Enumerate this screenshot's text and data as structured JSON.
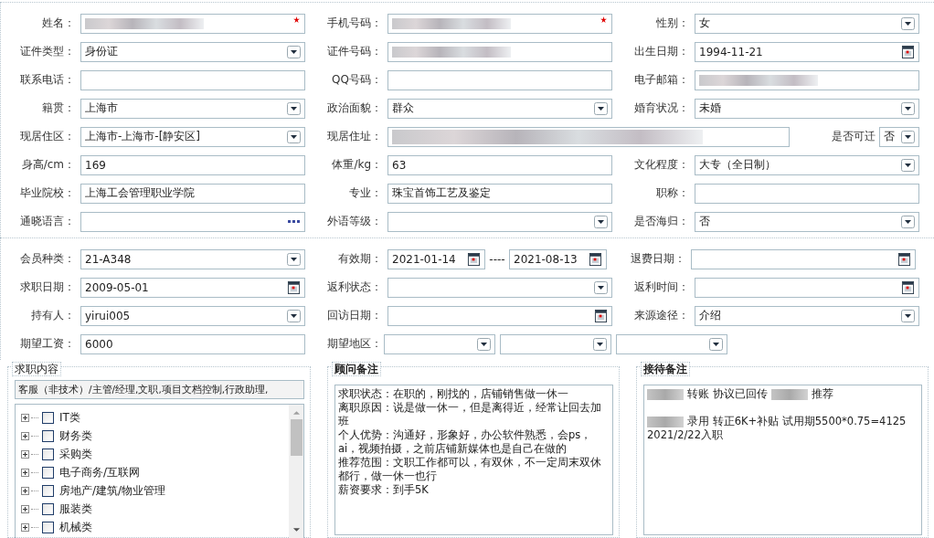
{
  "personal": [
    [
      {
        "label": "姓名：",
        "kind": "text",
        "redacted": true,
        "required": true
      },
      {
        "label": "手机号码：",
        "kind": "text",
        "redacted": true,
        "required": true
      },
      {
        "label": "性别：",
        "kind": "select",
        "value": "女"
      }
    ],
    [
      {
        "label": "证件类型：",
        "kind": "select",
        "value": "身份证"
      },
      {
        "label": "证件号码：",
        "kind": "text",
        "redacted": true
      },
      {
        "label": "出生日期：",
        "kind": "date",
        "value": "1994-11-21"
      }
    ],
    [
      {
        "label": "联系电话：",
        "kind": "text"
      },
      {
        "label": "QQ号码：",
        "kind": "text"
      },
      {
        "label": "电子邮箱：",
        "kind": "text",
        "redacted": true
      }
    ],
    [
      {
        "label": "籍贯：",
        "kind": "select",
        "value": "上海市"
      },
      {
        "label": "政治面貌：",
        "kind": "select",
        "value": "群众"
      },
      {
        "label": "婚育状况：",
        "kind": "select",
        "value": "未婚"
      }
    ],
    [
      {
        "label": "现居住区：",
        "kind": "select",
        "value": "上海市-上海市-[静安区]"
      },
      {
        "label": "现居住址：",
        "kind": "text",
        "redacted": true,
        "wide": true
      },
      {
        "label": "是否可迁",
        "kind": "select",
        "value": "否",
        "compact": true
      }
    ],
    [
      {
        "label": "身高/cm：",
        "kind": "text",
        "value": "169"
      },
      {
        "label": "体重/kg：",
        "kind": "text",
        "value": "63"
      },
      {
        "label": "文化程度：",
        "kind": "select",
        "value": "大专（全日制）"
      }
    ],
    [
      {
        "label": "毕业院校：",
        "kind": "text",
        "value": "上海工会管理职业学院"
      },
      {
        "label": "专业：",
        "kind": "text",
        "value": "珠宝首饰工艺及鉴定"
      },
      {
        "label": "职称：",
        "kind": "text"
      }
    ],
    [
      {
        "label": "通晓语言：",
        "kind": "lookup"
      },
      {
        "label": "外语等级：",
        "kind": "select"
      },
      {
        "label": "是否海归：",
        "kind": "select",
        "value": "否"
      }
    ]
  ],
  "membership": [
    [
      {
        "label": "会员种类：",
        "kind": "select",
        "value": "21-A348"
      },
      {
        "label": "有效期：",
        "kind": "date_range",
        "value": "2021-01-14",
        "separator": "----",
        "value_to": "2021-08-13"
      },
      {
        "label": "退费日期：",
        "kind": "date"
      }
    ],
    [
      {
        "label": "求职日期：",
        "kind": "date",
        "value": "2009-05-01"
      },
      {
        "label": "返利状态：",
        "kind": "select"
      },
      {
        "label": "返利时间：",
        "kind": "date"
      }
    ],
    [
      {
        "label": "持有人：",
        "kind": "select",
        "value": "yirui005"
      },
      {
        "label": "回访日期：",
        "kind": "date"
      },
      {
        "label": "来源途径：",
        "kind": "select",
        "value": "介绍"
      }
    ],
    [
      {
        "label": "期望工资：",
        "kind": "text",
        "value": "6000"
      },
      {
        "label": "期望地区：",
        "kind": "region"
      }
    ]
  ],
  "job_content": {
    "title": "求职内容",
    "summary": "客服（非技术）/主管/经理,文职,项目文档控制,行政助理,",
    "tree": [
      {
        "label": "IT类",
        "expanded": false,
        "checked": false
      },
      {
        "label": "财务类",
        "expanded": false,
        "checked": false
      },
      {
        "label": "采购类",
        "expanded": false,
        "checked": false
      },
      {
        "label": "电子商务/互联网",
        "expanded": false,
        "checked": false
      },
      {
        "label": "房地产/建筑/物业管理",
        "expanded": false,
        "checked": false
      },
      {
        "label": "服装类",
        "expanded": false,
        "checked": false
      },
      {
        "label": "机械类",
        "expanded": false,
        "checked": false
      }
    ]
  },
  "advisor_notes": {
    "title": "顾问备注",
    "lines": [
      "求职状态：在职的，刚找的，店铺销售做一休一",
      "离职原因：说是做一休一，但是离得近，经常让回去加班",
      "个人优势：沟通好，形象好，办公软件熟悉，会ps，ai，视频拍摄，之前店铺新媒体也是自己在做的",
      "推荐范围：文职工作都可以，有双休，不一定周末双休都行，做一休一也行",
      "薪资要求：到手5K"
    ]
  },
  "reception_notes": {
    "title": "接待备注",
    "paragraphs": [
      [
        {
          "parts": [
            {
              "kind": "redacted"
            },
            {
              "kind": "text",
              "text": "转账 协议已回传"
            },
            {
              "kind": "redacted"
            },
            {
              "kind": "text",
              "text": "推荐"
            }
          ]
        }
      ],
      [
        {
          "parts": [
            {
              "kind": "redacted"
            },
            {
              "kind": "text",
              "text": "录用 转正6K+补贴 试用期5500*0.75=4125"
            }
          ]
        },
        {
          "parts": [
            {
              "kind": "text",
              "text": "2021/2/22入职"
            }
          ]
        }
      ]
    ]
  }
}
